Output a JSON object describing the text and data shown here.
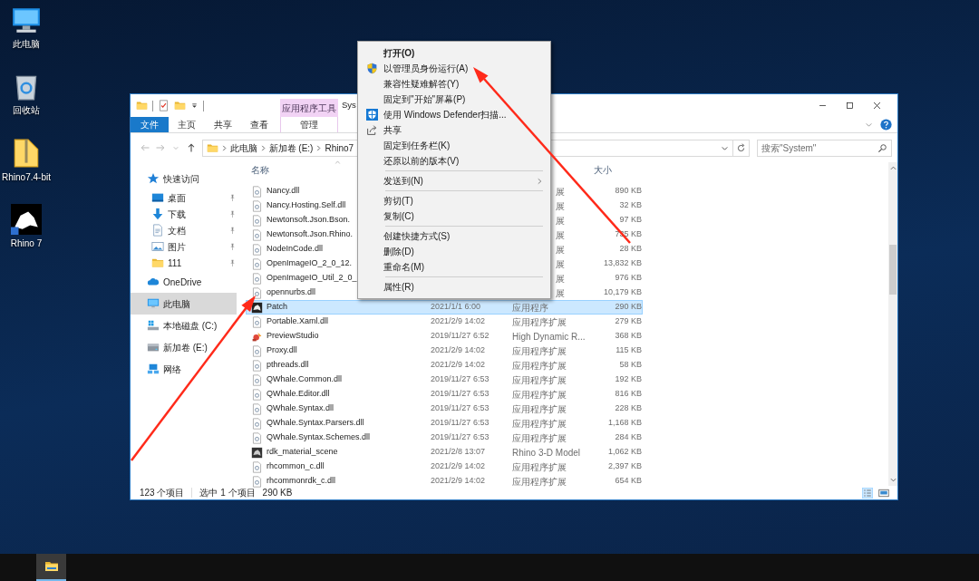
{
  "desktop_icons": [
    {
      "label": "此电脑",
      "kind": "pc"
    },
    {
      "label": "回收站",
      "kind": "bin"
    },
    {
      "label": "Rhino7.4-bit",
      "kind": "zip"
    },
    {
      "label": "Rhino 7",
      "kind": "logo"
    }
  ],
  "explorer": {
    "title": "Sys",
    "context_tab": "应用程序工具",
    "ribbon_tabs": [
      {
        "label": "文件",
        "kind": "file"
      },
      {
        "label": "主页",
        "kind": "tab"
      },
      {
        "label": "共享",
        "kind": "tab"
      },
      {
        "label": "查看",
        "kind": "tab"
      },
      {
        "label": "管理",
        "kind": "context"
      }
    ],
    "breadcrumb": [
      "此电脑",
      "新加卷 (E:)",
      "Rhino7"
    ],
    "search": {
      "placeholder": "搜索\"System\""
    },
    "nav": [
      {
        "label": "快速访问",
        "kind": "star",
        "pinned": false,
        "selected": false,
        "children": [
          {
            "label": "桌面",
            "kind": "desktop",
            "pinned": true,
            "selected": false
          },
          {
            "label": "下载",
            "kind": "download",
            "pinned": true,
            "selected": false
          },
          {
            "label": "文档",
            "kind": "docs",
            "pinned": true,
            "selected": false
          },
          {
            "label": "图片",
            "kind": "pictures",
            "pinned": true,
            "selected": false
          },
          {
            "label": "111",
            "kind": "folder",
            "pinned": true,
            "selected": false
          }
        ]
      },
      {
        "label": "OneDrive",
        "kind": "cloud",
        "pinned": false,
        "selected": false
      },
      {
        "label": "此电脑",
        "kind": "pc",
        "pinned": false,
        "selected": true
      },
      {
        "label": "本地磁盘 (C:)",
        "kind": "drive-c",
        "pinned": false,
        "selected": false
      },
      {
        "label": "新加卷 (E:)",
        "kind": "drive",
        "pinned": false,
        "selected": false
      },
      {
        "label": "网络",
        "kind": "network",
        "pinned": false,
        "selected": false
      }
    ],
    "header": {
      "name": "名称",
      "size": "大小"
    },
    "rows": [
      {
        "name": "Nancy.dll",
        "kind": "dll",
        "type": "展",
        "size": "890 KB",
        "selected": false
      },
      {
        "name": "Nancy.Hosting.Self.dll",
        "kind": "dll",
        "type": "展",
        "size": "32 KB",
        "selected": false
      },
      {
        "name": "Newtonsoft.Json.Bson.",
        "kind": "dll",
        "type": "展",
        "size": "97 KB",
        "selected": false
      },
      {
        "name": "Newtonsoft.Json.Rhino.",
        "kind": "dll",
        "type": "展",
        "size": "735 KB",
        "selected": false
      },
      {
        "name": "NodeInCode.dll",
        "kind": "dll",
        "type": "展",
        "size": "28 KB",
        "selected": false
      },
      {
        "name": "OpenImageIO_2_0_12.",
        "kind": "dll",
        "type": "展",
        "size": "13,832 KB",
        "selected": false
      },
      {
        "name": "OpenImageIO_Util_2_0_",
        "kind": "dll",
        "type": "展",
        "size": "976 KB",
        "selected": false
      },
      {
        "name": "opennurbs.dll",
        "kind": "dll",
        "type": "展",
        "size": "10,179 KB",
        "selected": false
      },
      {
        "name": "Patch",
        "kind": "app",
        "date": "2021/1/1 6:00",
        "type": "应用程序",
        "size": "290 KB",
        "selected": true
      },
      {
        "name": "Portable.Xaml.dll",
        "kind": "dll",
        "date": "2021/2/9 14:02",
        "type": "应用程序扩展",
        "size": "279 KB",
        "selected": false
      },
      {
        "name": "PreviewStudio",
        "kind": "preview",
        "date": "2019/11/27 6:52",
        "type": "High Dynamic R...",
        "size": "368 KB",
        "selected": false
      },
      {
        "name": "Proxy.dll",
        "kind": "dll",
        "date": "2021/2/9 14:02",
        "type": "应用程序扩展",
        "size": "115 KB",
        "selected": false
      },
      {
        "name": "pthreads.dll",
        "kind": "dll",
        "date": "2021/2/9 14:02",
        "type": "应用程序扩展",
        "size": "58 KB",
        "selected": false
      },
      {
        "name": "QWhale.Common.dll",
        "kind": "dll",
        "date": "2019/11/27 6:53",
        "type": "应用程序扩展",
        "size": "192 KB",
        "selected": false
      },
      {
        "name": "QWhale.Editor.dll",
        "kind": "dll",
        "date": "2019/11/27 6:53",
        "type": "应用程序扩展",
        "size": "816 KB",
        "selected": false
      },
      {
        "name": "QWhale.Syntax.dll",
        "kind": "dll",
        "date": "2019/11/27 6:53",
        "type": "应用程序扩展",
        "size": "228 KB",
        "selected": false
      },
      {
        "name": "QWhale.Syntax.Parsers.dll",
        "kind": "dll",
        "date": "2019/11/27 6:53",
        "type": "应用程序扩展",
        "size": "1,168 KB",
        "selected": false
      },
      {
        "name": "QWhale.Syntax.Schemes.dll",
        "kind": "dll",
        "date": "2019/11/27 6:53",
        "type": "应用程序扩展",
        "size": "284 KB",
        "selected": false
      },
      {
        "name": "rdk_material_scene",
        "kind": "model",
        "date": "2021/2/8 13:07",
        "type": "Rhino 3-D Model",
        "size": "1,062 KB",
        "selected": false
      },
      {
        "name": "rhcommon_c.dll",
        "kind": "dll",
        "date": "2021/2/9 14:02",
        "type": "应用程序扩展",
        "size": "2,397 KB",
        "selected": false
      },
      {
        "name": "rhcommonrdk_c.dll",
        "kind": "dll",
        "date": "2021/2/9 14:02",
        "type": "应用程序扩展",
        "size": "654 KB",
        "selected": false
      }
    ],
    "status_bar": {
      "count": "123 个项目",
      "selection": "选中 1 个项目",
      "size": "290 KB"
    }
  },
  "context_menu": [
    {
      "kind": "item",
      "label": "打开(O)",
      "bold": true,
      "submenu": false
    },
    {
      "kind": "shield-item",
      "label": "以管理员身份运行(A)",
      "bold": false,
      "submenu": false
    },
    {
      "kind": "item",
      "label": "兼容性疑难解答(Y)",
      "bold": false,
      "submenu": false
    },
    {
      "kind": "item",
      "label": "固定到\"开始\"屏幕(P)",
      "bold": false,
      "submenu": false
    },
    {
      "kind": "scan-item",
      "label": "使用 Windows Defender扫描...",
      "bold": false,
      "submenu": false
    },
    {
      "kind": "share-item",
      "label": "共享",
      "bold": false,
      "submenu": false
    },
    {
      "kind": "item",
      "label": "固定到任务栏(K)",
      "bold": false,
      "submenu": false
    },
    {
      "kind": "item",
      "label": "还原以前的版本(V)",
      "bold": false,
      "submenu": false
    },
    {
      "kind": "separator"
    },
    {
      "kind": "item",
      "label": "发送到(N)",
      "bold": false,
      "submenu": true
    },
    {
      "kind": "separator"
    },
    {
      "kind": "item",
      "label": "剪切(T)",
      "bold": false,
      "submenu": false
    },
    {
      "kind": "item",
      "label": "复制(C)",
      "bold": false,
      "submenu": false
    },
    {
      "kind": "separator"
    },
    {
      "kind": "item",
      "label": "创建快捷方式(S)",
      "bold": false,
      "submenu": false
    },
    {
      "kind": "item",
      "label": "删除(D)",
      "bold": false,
      "submenu": false
    },
    {
      "kind": "item",
      "label": "重命名(M)",
      "bold": false,
      "submenu": false
    },
    {
      "kind": "separator"
    },
    {
      "kind": "item",
      "label": "属性(R)",
      "bold": false,
      "submenu": false
    }
  ],
  "taskbar": {
    "apps": [
      {
        "kind": "explorer",
        "active": true
      }
    ]
  }
}
